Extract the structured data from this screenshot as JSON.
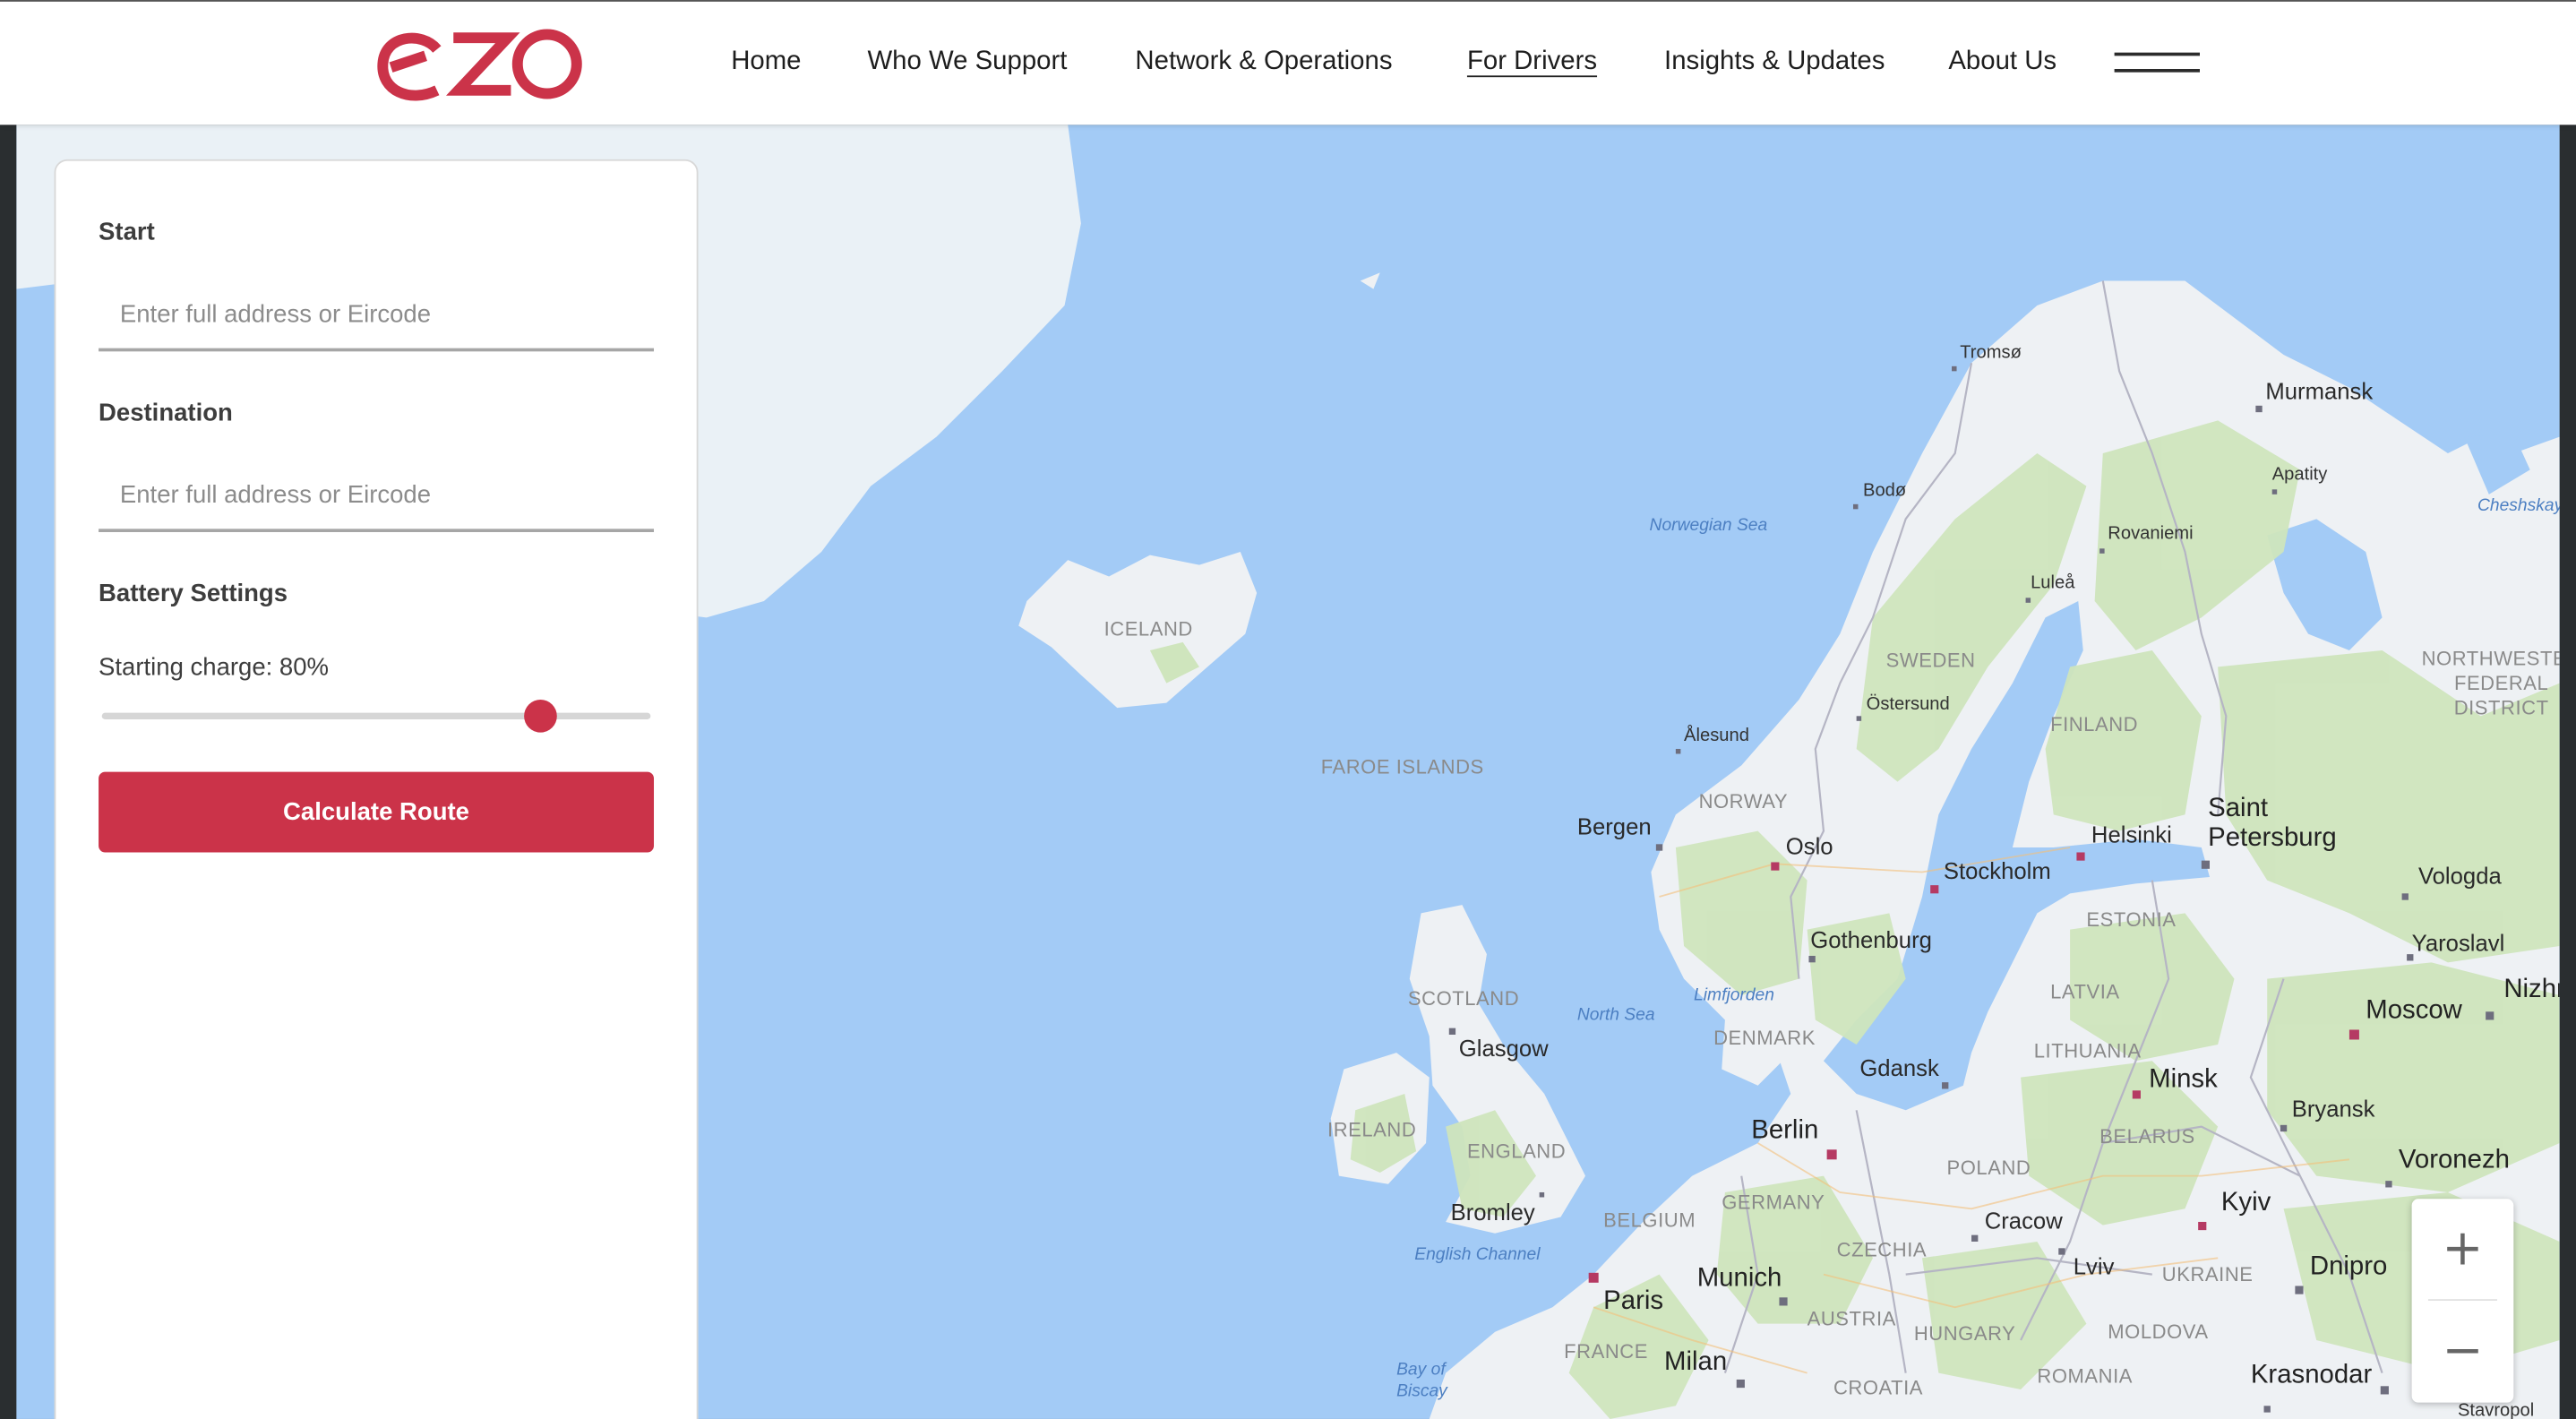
{
  "brand": {
    "logo_text": "ezo",
    "color": "#cb3349"
  },
  "nav": {
    "items": [
      {
        "label": "Home"
      },
      {
        "label": "Who We Support"
      },
      {
        "label": "Network & Operations"
      },
      {
        "label": "For Drivers",
        "active": true
      },
      {
        "label": "Insights & Updates"
      },
      {
        "label": "About Us"
      }
    ],
    "menu_icon": "hamburger-icon"
  },
  "panel": {
    "start": {
      "label": "Start",
      "placeholder": "Enter full address or Eircode",
      "value": ""
    },
    "destination": {
      "label": "Destination",
      "placeholder": "Enter full address or Eircode",
      "value": ""
    },
    "battery": {
      "heading": "Battery Settings",
      "charge_text": "Starting charge: 80%",
      "charge_percent": 80
    },
    "calculate_label": "Calculate Route"
  },
  "zoom": {
    "in_label": "+",
    "out_label": "−"
  },
  "map": {
    "colors": {
      "water": "#a3cbf6",
      "land": "#eef1f4",
      "forest": "#cfe5bd",
      "route_marker": "#b53a63"
    },
    "labels": {
      "tromso": "Tromsø",
      "murmansk": "Murmansk",
      "apatity": "Apatity",
      "bodo": "Bodø",
      "rovaniemi": "Rovaniemi",
      "lulea": "Luleå",
      "norwegian_sea": "Norwegian Sea",
      "cheshskaya": "Cheshskay",
      "iceland": "ICELAND",
      "sweden": "SWEDEN",
      "ostersund": "Östersund",
      "finland": "FINLAND",
      "alesund": "Ålesund",
      "nw_federal": "NORTHWESTER\nFEDERAL\nDISTRICT",
      "faroe": "FAROE ISLANDS",
      "norway": "NORWAY",
      "bergen": "Bergen",
      "oslo": "Oslo",
      "stockholm": "Stockholm",
      "helsinki": "Helsinki",
      "saint_petersburg": "Saint\nPetersburg",
      "vologda": "Vologda",
      "estonia": "ESTONIA",
      "gothenburg": "Gothenburg",
      "yaroslavl": "Yaroslavl",
      "scotland": "SCOTLAND",
      "north_sea": "North Sea",
      "limfjorden": "Limfjorden",
      "latvia": "LATVIA",
      "moscow": "Moscow",
      "nizhny": "Nizhn",
      "glasgow": "Glasgow",
      "denmark": "DENMARK",
      "lithuania": "LITHUANIA",
      "gdansk": "Gdansk",
      "minsk": "Minsk",
      "bryansk": "Bryansk",
      "ireland": "IRELAND",
      "berlin": "Berlin",
      "belarus": "BELARUS",
      "england": "ENGLAND",
      "voronezh": "Voronezh",
      "poland": "POLAND",
      "kyiv": "Kyiv",
      "bromley": "Bromley",
      "germany": "GERMANY",
      "cracow": "Cracow",
      "belgium": "BELGIUM",
      "english_channel": "English Channel",
      "czechia": "CZECHIA",
      "lviv": "Lviv",
      "dnipro": "Dnipro",
      "ukraine": "UKRAINE",
      "munich": "Munich",
      "paris": "Paris",
      "austria": "AUSTRIA",
      "hungary": "HUNGARY",
      "moldova": "MOLDOVA",
      "france": "FRANCE",
      "milan": "Milan",
      "bay_of_biscay": "Bay of\nBiscay",
      "croatia": "CROATIA",
      "romania": "ROMANIA",
      "krasnodar": "Krasnodar",
      "stavropol": "Stavropol"
    }
  }
}
